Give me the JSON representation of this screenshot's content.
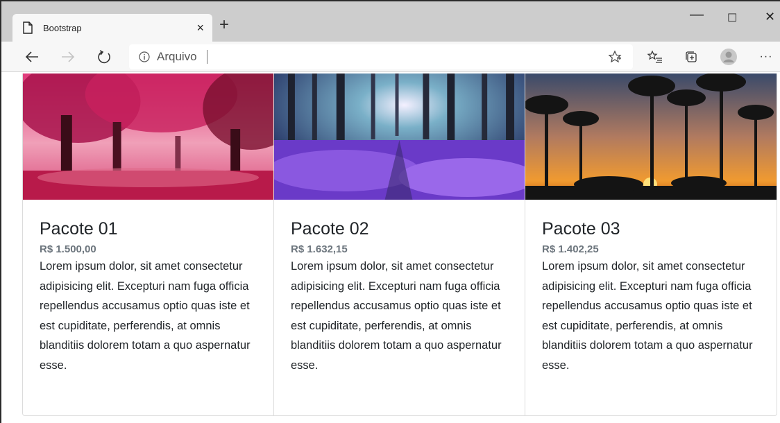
{
  "browser": {
    "tab_title": "Bootstrap",
    "tab_close": "×",
    "new_tab": "+",
    "address_label": "Arquivo",
    "window_controls": {
      "minimize": "—",
      "maximize": "☐",
      "close": "✕"
    },
    "toolbar_icons": [
      "back-icon",
      "forward-icon",
      "refresh-icon",
      "info-icon",
      "favorite-star-icon",
      "favorites-list-icon",
      "collections-icon",
      "profile-avatar-icon",
      "more-menu-icon"
    ],
    "more_label": "···"
  },
  "cards": [
    {
      "title": "Pacote 01",
      "price": "R$ 1.500,00",
      "text": "Lorem ipsum dolor, sit amet consectetur adipisicing elit. Excepturi nam fuga officia repellendus accusamus optio quas iste et est cupiditate, perferendis, at omnis blanditiis dolorem totam a quo aspernatur esse.",
      "image": "pink-autumn-forest"
    },
    {
      "title": "Pacote 02",
      "price": "R$ 1.632,15",
      "text": "Lorem ipsum dolor, sit amet consectetur adipisicing elit. Excepturi nam fuga officia repellendus accusamus optio quas iste et est cupiditate, perferendis, at omnis blanditiis dolorem totam a quo aspernatur esse.",
      "image": "purple-flower-forest"
    },
    {
      "title": "Pacote 03",
      "price": "R$ 1.402,25",
      "text": "Lorem ipsum dolor, sit amet consectetur adipisicing elit. Excepturi nam fuga officia repellendus accusamus optio quas iste et est cupiditate, perferendis, at omnis blanditiis dolorem totam a quo aspernatur esse.",
      "image": "palm-tree-sunset"
    }
  ]
}
